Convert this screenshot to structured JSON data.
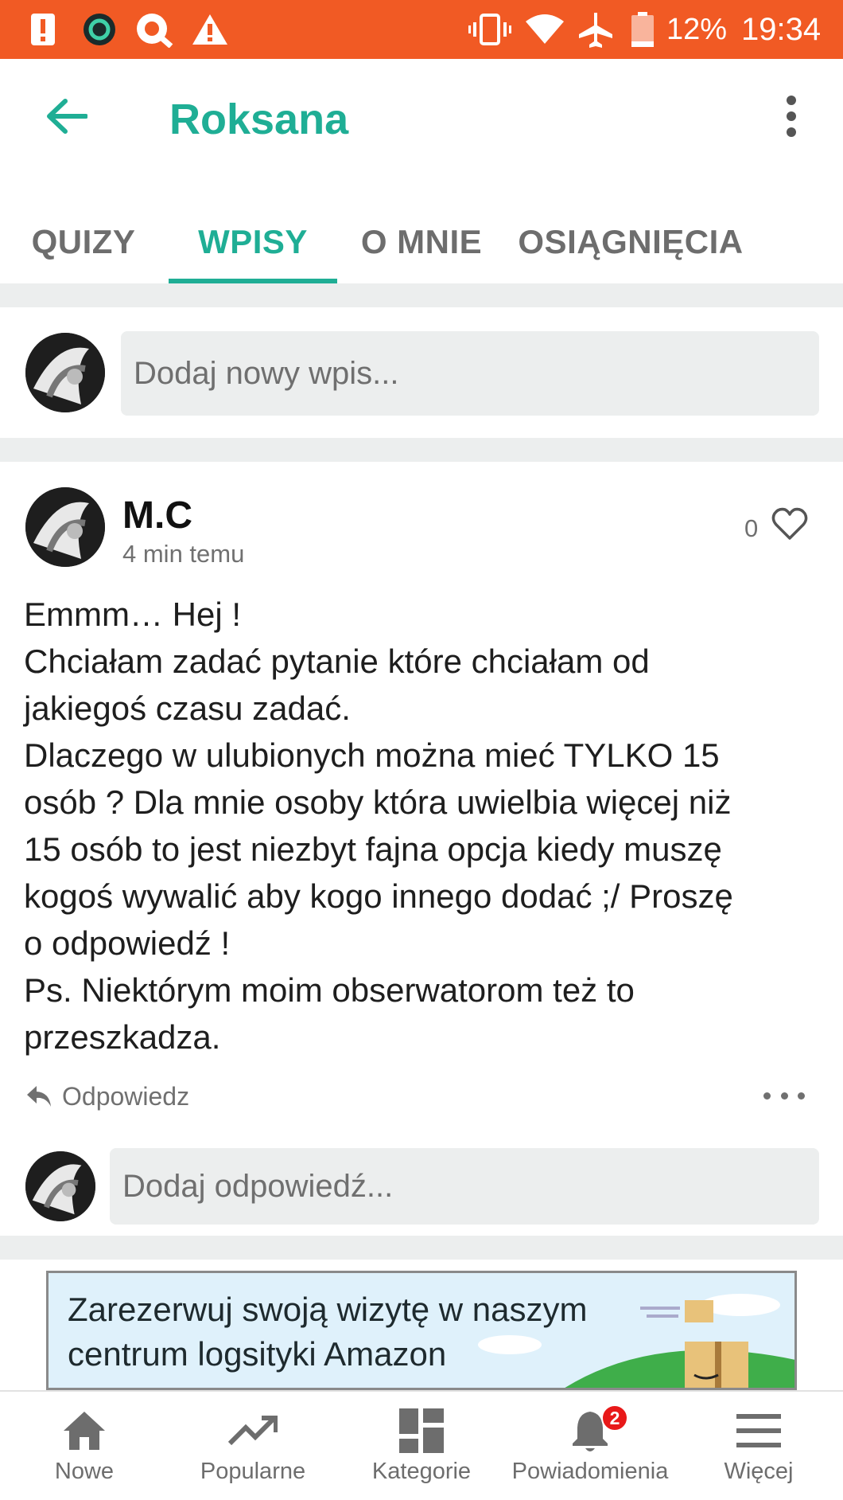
{
  "status_bar": {
    "battery": "12%",
    "time": "19:34",
    "icons": [
      "alert-icon",
      "app-icon",
      "q-app-icon",
      "warning-icon",
      "vibrate-icon",
      "wifi-icon",
      "airplane-icon",
      "battery-icon"
    ]
  },
  "header": {
    "title": "Roksana"
  },
  "tabs": [
    {
      "label": "QUIZY"
    },
    {
      "label": "WPISY",
      "active": true
    },
    {
      "label": "O MNIE"
    },
    {
      "label": "OSIĄGNIĘCIA"
    }
  ],
  "new_post": {
    "placeholder": "Dodaj nowy wpis..."
  },
  "post": {
    "author": "M.C",
    "time": "4 min temu",
    "likes": "0",
    "body_lines": [
      "Emmm… Hej !",
      "Chciałam zadać pytanie które chciałam od",
      "jakiegoś czasu zadać.",
      "Dlaczego w ulubionych można mieć TYLKO 15",
      "osób ? Dla mnie osoby która uwielbia więcej niż",
      "15 osób to jest niezbyt fajna opcja kiedy muszę",
      "kogoś wywalić aby kogo innego dodać ;/ Proszę",
      "o odpowiedź !",
      "Ps. Niektórym moim obserwatorom też to",
      "przeszkadza."
    ],
    "reply_label": "Odpowiedz",
    "reply_placeholder": "Dodaj odpowiedź..."
  },
  "ad": {
    "line1": "Zarezerwuj swoją wizytę w naszym",
    "line2": "centrum logsityki Amazon"
  },
  "bottom_nav": [
    {
      "label": "Nowe",
      "icon": "home-icon"
    },
    {
      "label": "Popularne",
      "icon": "trending-icon"
    },
    {
      "label": "Kategorie",
      "icon": "dashboard-icon"
    },
    {
      "label": "Powiadomienia",
      "icon": "bell-icon",
      "badge": "2"
    },
    {
      "label": "Więcej",
      "icon": "menu-icon"
    }
  ],
  "colors": {
    "status_bar": "#f15a24",
    "accent": "#1fae95",
    "badge": "#e81919"
  }
}
